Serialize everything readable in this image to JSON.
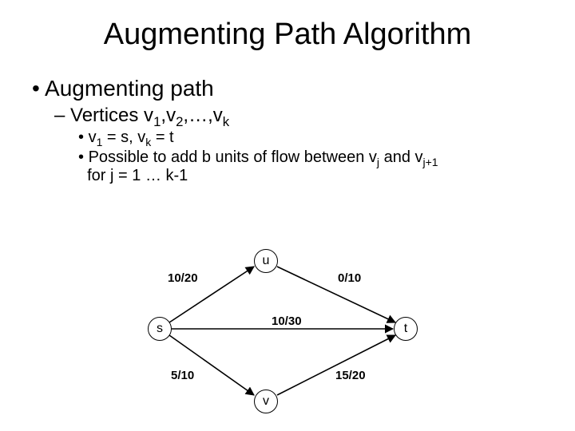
{
  "title": "Augmenting Path Algorithm",
  "bullet_l1": "Augmenting path",
  "bullet_l2_prefix": "Vertices v",
  "bullet_l2_seq": ",v",
  "bullet_l2_ellipsis": ",…,v",
  "bullet_l3a_part1": "v",
  "bullet_l3a_part2": " = s,  v",
  "bullet_l3a_part3": " = t",
  "bullet_l3b_part1": "Possible to add b units of flow between v",
  "bullet_l3b_part2": " and v",
  "bullet_l3b_part3": "for j = 1 … k-1",
  "nodes": {
    "u": "u",
    "s": "s",
    "t": "t",
    "v": "v"
  },
  "edges": {
    "su": "10/20",
    "ut": "0/10",
    "st": "10/30",
    "sv": "5/10",
    "vt": "15/20"
  },
  "chart_data": {
    "type": "graph",
    "title": "Flow network with flow/capacity labels",
    "nodes": [
      {
        "id": "s",
        "label": "s"
      },
      {
        "id": "u",
        "label": "u"
      },
      {
        "id": "v",
        "label": "v"
      },
      {
        "id": "t",
        "label": "t"
      }
    ],
    "edges": [
      {
        "from": "s",
        "to": "u",
        "flow": 10,
        "capacity": 20,
        "label": "10/20"
      },
      {
        "from": "u",
        "to": "t",
        "flow": 0,
        "capacity": 10,
        "label": "0/10"
      },
      {
        "from": "s",
        "to": "t",
        "flow": 10,
        "capacity": 30,
        "label": "10/30"
      },
      {
        "from": "s",
        "to": "v",
        "flow": 5,
        "capacity": 10,
        "label": "5/10"
      },
      {
        "from": "v",
        "to": "t",
        "flow": 15,
        "capacity": 20,
        "label": "15/20"
      }
    ]
  }
}
